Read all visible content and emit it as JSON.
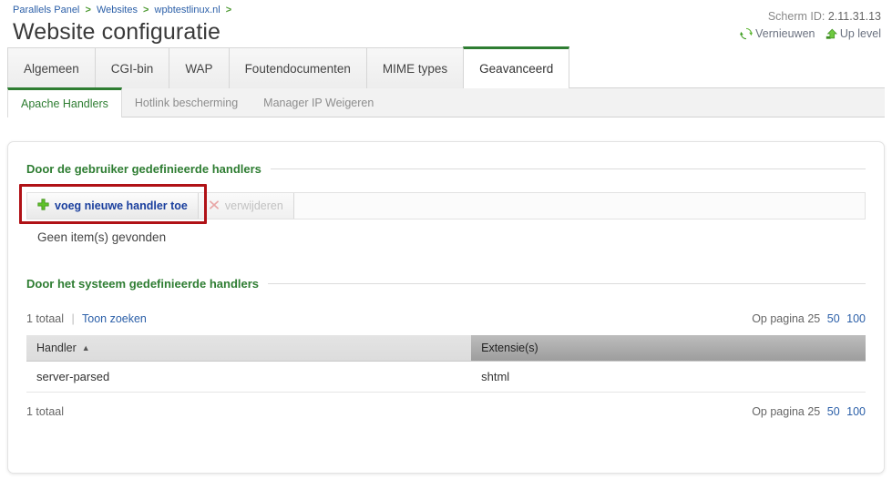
{
  "breadcrumb": {
    "items": [
      {
        "label": "Parallels Panel"
      },
      {
        "label": "Websites"
      },
      {
        "label": "wpbtestlinux.nl"
      }
    ],
    "separator": ">"
  },
  "header": {
    "title": "Website configuratie",
    "screen_id_label": "Scherm ID:",
    "screen_id_value": "2.11.31.13",
    "refresh_label": "Vernieuwen",
    "refresh_icon": "refresh-icon",
    "uplevel_label": "Up level",
    "uplevel_icon": "up-level-icon"
  },
  "tabs": [
    {
      "label": "Algemeen",
      "active": false
    },
    {
      "label": "CGI-bin",
      "active": false
    },
    {
      "label": "WAP",
      "active": false
    },
    {
      "label": "Foutendocumenten",
      "active": false
    },
    {
      "label": "MIME types",
      "active": false
    },
    {
      "label": "Geavanceerd",
      "active": true
    }
  ],
  "subtabs": [
    {
      "label": "Apache Handlers",
      "active": true
    },
    {
      "label": "Hotlink bescherming",
      "active": false
    },
    {
      "label": "Manager IP Weigeren",
      "active": false
    }
  ],
  "user_section": {
    "title": "Door de gebruiker gedefinieerde handlers",
    "add_button": {
      "label": "voeg nieuwe handler toe",
      "icon": "plus-icon"
    },
    "delete_button": {
      "label": "verwijderen",
      "icon": "remove-x-icon",
      "disabled": true
    },
    "empty_message": "Geen item(s) gevonden"
  },
  "system_section": {
    "title": "Door het systeem gedefinieerde handlers",
    "pager_top": {
      "total": "1 totaal",
      "search_link": "Toon zoeken",
      "per_page_label": "Op pagina",
      "per_page_current": "25",
      "per_page_options": [
        "50",
        "100"
      ]
    },
    "table": {
      "columns": [
        {
          "label": "Handler",
          "sort": "asc",
          "sort_glyph": "▲"
        },
        {
          "label": "Extensie(s)",
          "sort": "none"
        }
      ],
      "rows": [
        {
          "handler": "server-parsed",
          "extensions": "shtml"
        }
      ]
    },
    "pager_bottom": {
      "total": "1 totaal",
      "per_page_label": "Op pagina",
      "per_page_current": "25",
      "per_page_options": [
        "50",
        "100"
      ]
    }
  },
  "colors": {
    "accent_green": "#2e7d32",
    "link_blue": "#2b5fa8",
    "button_blue": "#1a3f9e",
    "highlight_red": "#b01116"
  }
}
